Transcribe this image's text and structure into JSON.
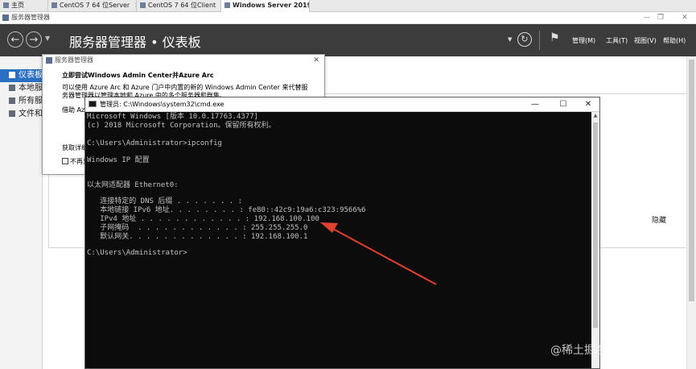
{
  "vm_tabs": [
    {
      "label": "主页",
      "active": false
    },
    {
      "label": "CentOS 7 64 位Server",
      "active": false
    },
    {
      "label": "CentOS 7 64 位Client",
      "active": false
    },
    {
      "label": "Windows Server 2019",
      "active": true
    }
  ],
  "server_manager": {
    "window_title": "服务器管理器",
    "header_title": "服务器管理器 • 仪表板",
    "menus": [
      "管理(M)",
      "工具(T)",
      "视图(V)",
      "帮助(H)"
    ],
    "sidebar": [
      {
        "label": "仪表板",
        "active": true
      },
      {
        "label": "本地服务器",
        "active": false
      },
      {
        "label": "所有服务器",
        "active": false
      },
      {
        "label": "文件和存储服务",
        "active": false
      }
    ],
    "hide_label": "隐藏"
  },
  "popup": {
    "title": "服务器管理器",
    "heading": "立即尝试Windows Admin Center并Azure Arc",
    "body": "可以使用 Azure Arc 和 Azure 门户中内置的新的 Windows Admin Center 来代替服务器管理器以管理本地和 Azure 中的多个服务器和群集。",
    "body2": "借助 Azure Arc",
    "obtain": "获取详细信息",
    "checkbox": "不再显示此消息"
  },
  "cmd": {
    "title": "管理员: C:\\Windows\\system32\\cmd.exe",
    "lines": [
      "Microsoft Windows [版本 10.0.17763.4377]",
      "(c) 2018 Microsoft Corporation。保留所有权利。",
      "",
      "C:\\Users\\Administrator>ipconfig",
      "",
      "Windows IP 配置",
      "",
      "",
      "以太网适配器 Ethernet0:",
      "",
      "   连接特定的 DNS 后缀 . . . . . . . :",
      "   本地链接 IPv6 地址. . . . . . . . : fe80::42c9:19a6:c323:9566%6",
      "   IPv4 地址 . . . . . . . . . . . . : 192.168.100.100",
      "   子网掩码  . . . . . . . . . . . . : 255.255.255.0",
      "   默认网关. . . . . . . . . . . . . : 192.168.100.1",
      "",
      "C:\\Users\\Administrator>"
    ]
  },
  "watermark": "@稀土掘金技术社区",
  "colors": {
    "arrow": "#e2402f",
    "accent": "#2a6fc1",
    "header_bg": "#3c3c3c"
  }
}
